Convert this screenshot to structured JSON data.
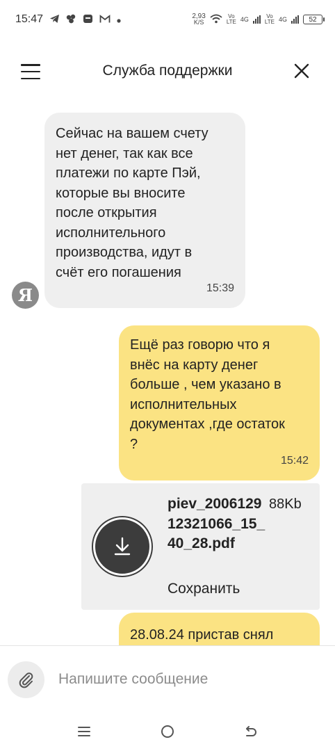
{
  "status_bar": {
    "time": "15:47",
    "icons": [
      "telegram-icon",
      "app-icon",
      "messenger-icon",
      "gmail-icon",
      "dot-icon"
    ],
    "net_speed_value": "2,93",
    "net_speed_unit": "K/S",
    "network1_top": "Vo",
    "network1_bottom": "LTE",
    "network1_type": "4G",
    "network2_top": "Vo",
    "network2_bottom": "LTE",
    "network2_type": "4G",
    "battery": "52"
  },
  "header": {
    "title": "Служба поддержки",
    "menu_icon": "hamburger-icon",
    "close_icon": "close-icon"
  },
  "messages": [
    {
      "direction": "incoming",
      "text": "Сейчас на вашем счету\nнет денег, так как все\nплатежи по карте Пэй,\nкоторые вы вносите\nпосле открытия\nисполнительного\nпроизводства, идут в\nсчёт его погашения",
      "time": "15:39",
      "avatar_letter": "Я"
    },
    {
      "direction": "outgoing",
      "text": "Ещё раз говорю что я\nвнёс на карту денег\nбольше , чем указано в\nисполнительных\nдокументах ,где остаток\n?",
      "time": "15:42"
    },
    {
      "direction": "incoming",
      "type": "file",
      "file_name": "piev_200612912321066_15_40_28.pdf",
      "file_size": "88Kb",
      "action_label": "Сохранить"
    },
    {
      "direction": "outgoing",
      "text": "28.08.24 пристав снял"
    }
  ],
  "composer": {
    "placeholder": "Напишите сообщение",
    "value": "",
    "attach_icon": "paperclip-icon"
  },
  "nav_bar": {
    "icons": [
      "recent-apps-icon",
      "home-icon",
      "back-icon"
    ]
  },
  "colors": {
    "incoming_bubble": "#efefef",
    "outgoing_bubble": "#fbe383",
    "avatar_bg": "#8a8a8a",
    "download_button": "#3c3c3c"
  }
}
